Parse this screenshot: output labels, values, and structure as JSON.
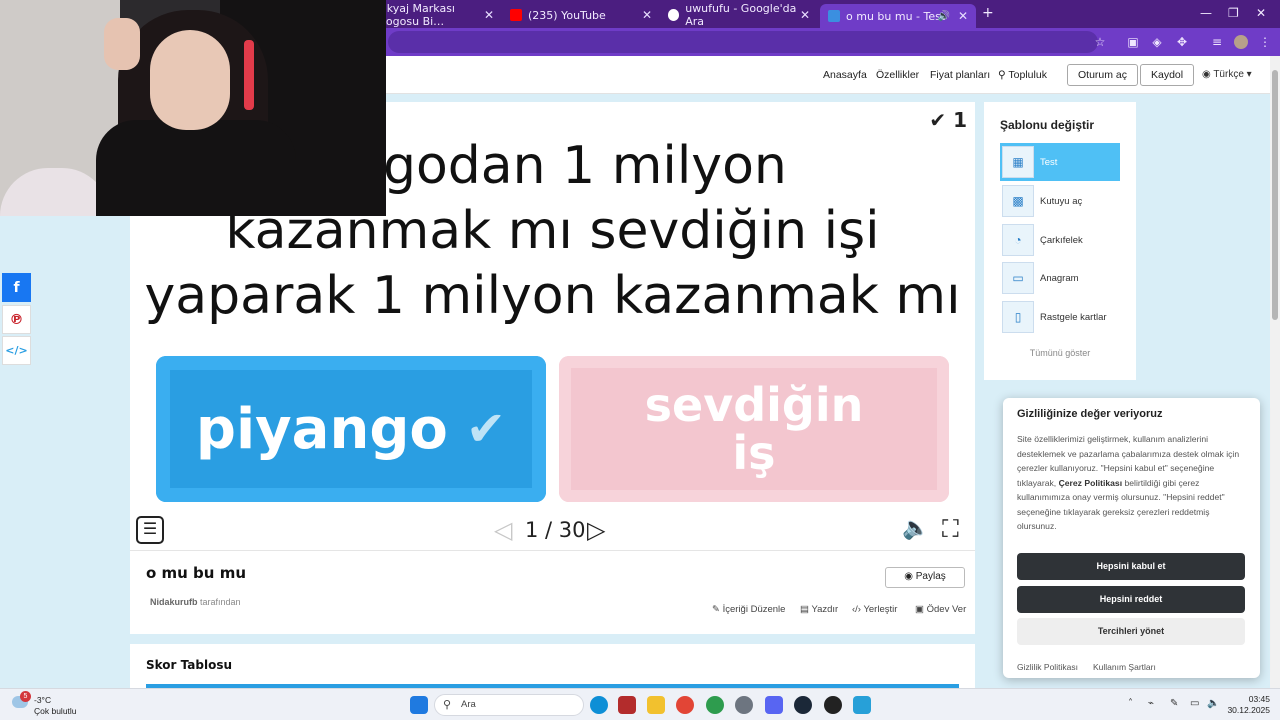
{
  "browser": {
    "tabs": [
      {
        "title": "akyaj Markası Logosu Bi…",
        "icon_color": "#f0f0f0"
      },
      {
        "title": "(235) YouTube",
        "icon_color": "#ff0000"
      },
      {
        "title": "uwufufu - Google'da Ara",
        "icon_color": "#ffffff"
      },
      {
        "title": "o mu bu mu - Test",
        "icon_color": "#3b8fe0"
      }
    ]
  },
  "nav": {
    "home": "Anasayfa",
    "features": "Özellikler",
    "pricing": "Fiyat planları",
    "community": "Topluluk",
    "login": "Oturum aç",
    "signup": "Kaydol",
    "language": "Türkçe"
  },
  "activity": {
    "score": "1",
    "question_lines": [
      "angodan 1 milyon",
      "kazanmak mı sevdiğin işi",
      "yaparak 1 milyon kazanmak mı"
    ],
    "answer_correct": "piyango",
    "answer_wrong_lines": [
      "sevdiğin",
      "iş"
    ],
    "pager": "1 / 30"
  },
  "info": {
    "title": "o mu bu mu",
    "author_name": "Nidakurufb",
    "author_suffix": "tarafından",
    "share": "Paylaş",
    "edit": "İçeriği Düzenle",
    "print": "Yazdır",
    "embed": "Yerleştir",
    "assign": "Ödev Ver"
  },
  "leaderboard": {
    "title": "Skor Tablosu"
  },
  "templates": {
    "title": "Şablonu değiştir",
    "items": [
      {
        "label": "Test"
      },
      {
        "label": "Kutuyu aç"
      },
      {
        "label": "Çarkıfelek"
      },
      {
        "label": "Anagram"
      },
      {
        "label": "Rastgele kartlar"
      }
    ],
    "show_all": "Tümünü göster"
  },
  "cookie": {
    "title": "Gizliliğinize değer veriyoruz",
    "body_1": "Site özelliklerimizi geliştirmek, kullanım analizlerini desteklemek ve pazarlama çabalarımıza destek olmak için çerezler kullanıyoruz. \"Hepsini kabul et\" seçeneğine tıklayarak, ",
    "body_bold": "Çerez Politikası",
    "body_2": " belirtildiği gibi çerez kullanımımıza onay vermiş olursunuz. \"Hepsini reddet\" seçeneğine tıklayarak gereksiz çerezleri reddetmiş olursunuz.",
    "accept": "Hepsini kabul et",
    "reject": "Hepsini reddet",
    "manage": "Tercihleri yönet",
    "privacy": "Gizlilik Politikası",
    "terms": "Kullanım Şartları"
  },
  "taskbar": {
    "weather_badge": "5",
    "temp": "-3°C",
    "weather_desc": "Çok bulutlu",
    "search": "Ara",
    "time": "03:45",
    "date": "30.12.2025"
  },
  "colors": {
    "tabbar": "#4b1e80",
    "addressbar": "#6f3cc7",
    "correct": "#2a9ee2",
    "wrong": "#f3c6cf",
    "selected_template": "#4fc0f5"
  }
}
